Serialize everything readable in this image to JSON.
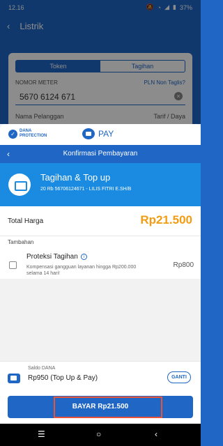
{
  "status_bar": {
    "time": "12.16",
    "battery": "37%"
  },
  "background_screen": {
    "title": "Listrik",
    "tabs": [
      "Token",
      "Tagihan"
    ],
    "meter_label": "NOMOR METER",
    "meter_link": "PLN Non Taglis?",
    "meter_value": "5670 6124 671",
    "customer_label": "Nama Pelanggan",
    "tariff_label": "Tarif / Daya"
  },
  "sheet": {
    "protection_label_1": "DANA",
    "protection_label_2": "PROTECTION",
    "pay_label": "PAY",
    "header_title": "Konfirmasi Pembayaran",
    "bill": {
      "title": "Tagihan & Top up",
      "subtitle": "20 Rb 56706124671 - LILIS FITRI E.SH/B"
    },
    "total_label": "Total Harga",
    "total_value": "Rp21.500",
    "extras_label": "Tambahan",
    "protection_title": "Proteksi Tagihan",
    "protection_desc": "Kompensasi gangguan layanan hingga Rp200.000 selama 14 hari!",
    "protection_price": "Rp800",
    "balance_label": "Saldo DANA",
    "balance_value": "Rp950 (Top Up & Pay)",
    "change_label": "GANTI",
    "pay_button_label": "BAYAR Rp21.500"
  },
  "colors": {
    "primary": "#1f66c5",
    "accent": "#f39c12",
    "highlight": "#e8543a"
  }
}
